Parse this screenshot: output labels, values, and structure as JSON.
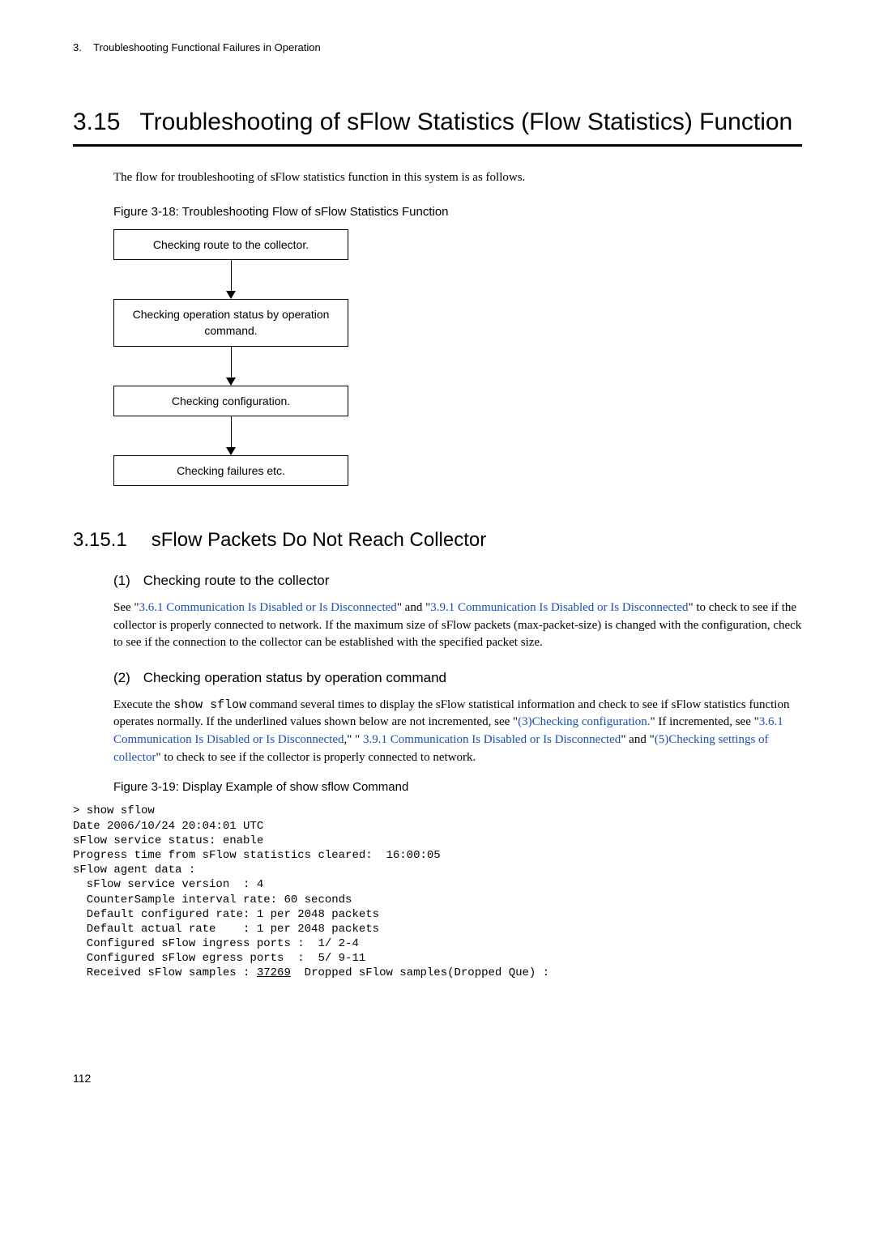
{
  "header": {
    "chapter_num": "3.",
    "chapter_title": "Troubleshooting Functional Failures in Operation"
  },
  "section": {
    "number": "3.15",
    "title": "Troubleshooting of sFlow Statistics (Flow Statistics) Function",
    "intro": "The flow for troubleshooting of sFlow statistics function in this system is as follows."
  },
  "figure18": {
    "caption": "Figure 3-18: Troubleshooting Flow of sFlow Statistics Function",
    "boxes": [
      "Checking route to the collector.",
      "Checking operation status by operation command.",
      "Checking configuration.",
      "Checking failures etc."
    ]
  },
  "subsection": {
    "number": "3.15.1",
    "title": "sFlow Packets Do Not Reach Collector"
  },
  "sub1": {
    "num": "(1)",
    "title": "Checking route to the collector",
    "text_pre": "See \"",
    "link1": "3.6.1 Communication Is Disabled or Is Disconnected",
    "mid1": "\" and \"",
    "link2": "3.9.1 Communication Is Disabled or Is Disconnected",
    "text_post": "\" to check to see if the collector is properly connected to network. If the maximum size of sFlow packets (max-packet-size) is changed with the configuration, check to see if the connection to the collector can be established with the specified packet size."
  },
  "sub2": {
    "num": "(2)",
    "title": "Checking operation status by operation command",
    "text_pre": "Execute the ",
    "cmd": "show sflow",
    "text_1": " command several times to display the sFlow statistical information and check to see if sFlow statistics function operates normally. If the underlined values shown below are not incremented, see \"",
    "link1": "(3)Checking configuration.",
    "text_2": "\" If incremented, see \"",
    "link2": "3.6.1 Communication Is Disabled or Is Disconnected",
    "text_3": ",\" \" ",
    "link3": "3.9.1 Communication Is Disabled or Is Disconnected",
    "text_4": "\" and \"",
    "link4": "(5)Checking settings of collector",
    "text_5": "\" to check to see if the collector is properly connected to network."
  },
  "figure19": {
    "caption": "Figure 3-19: Display Example of show sflow Command"
  },
  "code": {
    "l01": "> show sflow",
    "l02": "Date 2006/10/24 20:04:01 UTC",
    "l03": "sFlow service status: enable",
    "l04": "Progress time from sFlow statistics cleared:  16:00:05",
    "l05": "sFlow agent data :",
    "l06": "  sFlow service version  : 4",
    "l07": "  CounterSample interval rate: 60 seconds",
    "l08": "  Default configured rate: 1 per 2048 packets",
    "l09": "  Default actual rate    : 1 per 2048 packets",
    "l10": "  Configured sFlow ingress ports :  1/ 2-4",
    "l11": "  Configured sFlow egress ports  :  5/ 9-11",
    "l12a": "  Received sFlow samples : ",
    "l12u": "37269",
    "l12b": "  Dropped sFlow samples(Dropped Que) :"
  },
  "page_number": "112"
}
